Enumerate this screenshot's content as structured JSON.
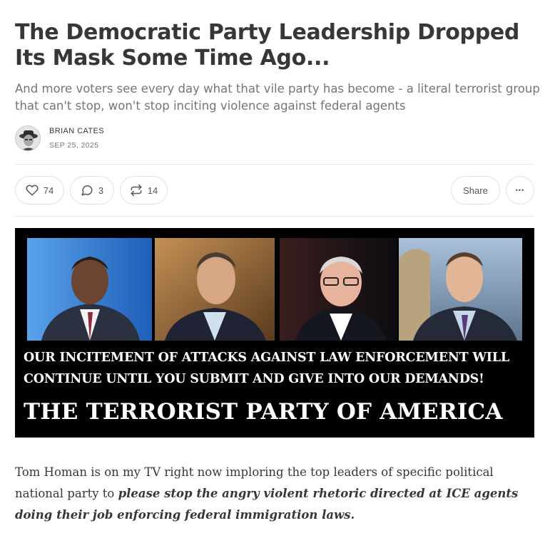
{
  "post": {
    "title": "The Democratic Party Leadership Dropped Its Mask Some Time Ago...",
    "subtitle": "And more voters see every day what that vile party has become - a literal terrorist group that can't stop, won't stop inciting violence against federal agents",
    "author": "BRIAN CATES",
    "date": "SEP 25, 2025"
  },
  "actions": {
    "likes": "74",
    "comments": "3",
    "restacks": "14",
    "share_label": "Share",
    "more_label": "•••"
  },
  "banner": {
    "line1": "OUR INCITEMENT OF ATTACKS AGAINST LAW ENFORCEMENT WILL",
    "line2": "CONTINUE UNTIL YOU SUBMIT AND GIVE INTO OUR DEMANDS!",
    "line3": "THE TERRORIST PARTY OF AMERICA"
  },
  "body": {
    "text_plain": "Tom Homan is on my TV right now imploring the top leaders of specific political national party to ",
    "text_emphasis": "please stop the angry violent rhetoric directed at ICE agents doing their job enforcing federal immigration laws."
  },
  "icons": [
    "heart-icon",
    "comment-icon",
    "restack-icon",
    "more-icon"
  ]
}
